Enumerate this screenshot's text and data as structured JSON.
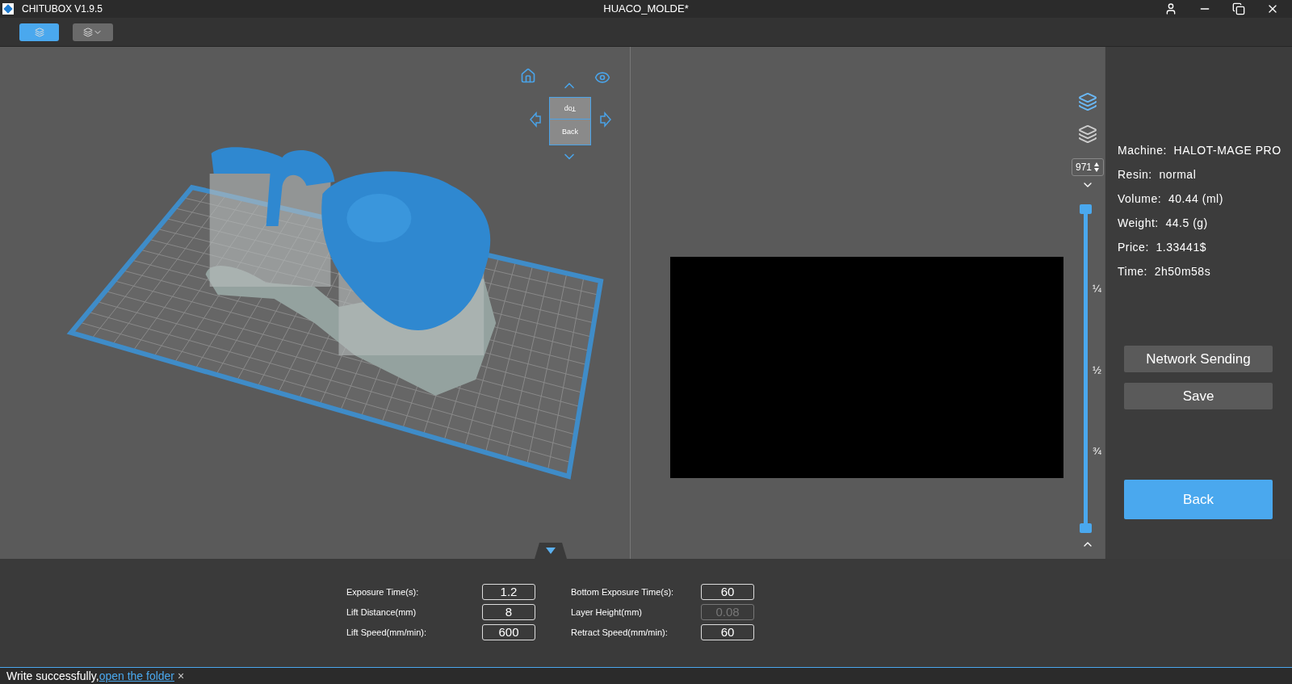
{
  "window": {
    "app_title": "CHITUBOX V1.9.5",
    "document_title": "HUACO_MOLDE*"
  },
  "toolbar": [
    {
      "kind": "slice",
      "selected": true
    },
    {
      "kind": "export",
      "selected": false
    }
  ],
  "view_cube": {
    "top_label": "Top",
    "front_label": "Back"
  },
  "layer_slider": {
    "layer": "971",
    "level": 1,
    "marks": [
      "¼",
      "½",
      "¾"
    ]
  },
  "info": [
    {
      "label": "Machine:",
      "value": "HALOT-MAGE PRO"
    },
    {
      "label": "Resin:",
      "value": "normal"
    },
    {
      "label": "Volume:",
      "value": "40.44  (ml)"
    },
    {
      "label": "Weight:",
      "value": "44.5  (g)"
    },
    {
      "label": "Price:",
      "value": "1.33441$"
    },
    {
      "label": "Time:",
      "value": "2h50m58s"
    }
  ],
  "actions": [
    {
      "label": "Network Sending",
      "kind": "secondary"
    },
    {
      "label": "Save",
      "kind": "secondary"
    },
    {
      "label": "Back",
      "kind": "primary"
    }
  ],
  "parameters": [
    {
      "label": "Exposure Time(s):",
      "value": "1.2",
      "disabled": false
    },
    {
      "label": "Bottom Exposure Time(s):",
      "value": "60",
      "disabled": false
    },
    {
      "label": "Lift Distance(mm)",
      "value": "8",
      "disabled": false
    },
    {
      "label": "Layer Height(mm)",
      "value": "0.08",
      "disabled": true
    },
    {
      "label": "Lift Speed(mm/min):",
      "value": "600",
      "disabled": false
    },
    {
      "label": "Retract Speed(mm/min):",
      "value": "60",
      "disabled": false
    }
  ],
  "status": {
    "message": "Write successfully,",
    "link": "open the folder",
    "close": "×"
  }
}
